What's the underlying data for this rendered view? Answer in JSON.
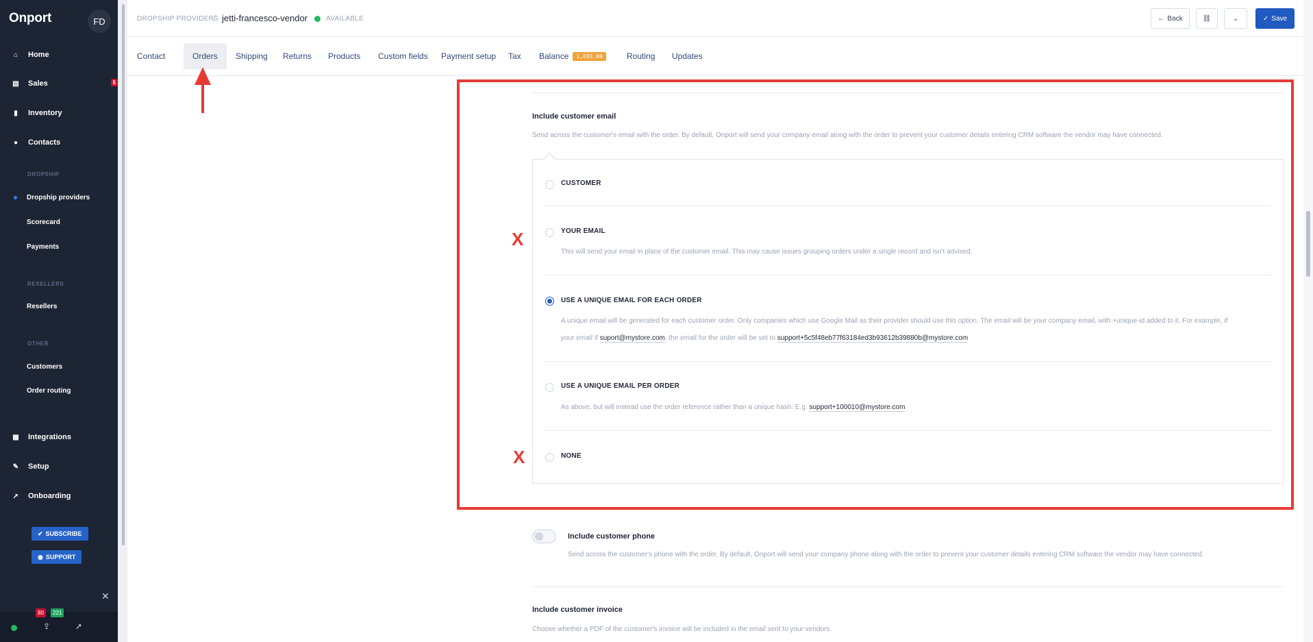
{
  "app": {
    "logo": "Onport",
    "user_initials": "FD"
  },
  "sidebar": {
    "nav": [
      {
        "label": "Home",
        "icon": "home-icon"
      },
      {
        "label": "Sales",
        "icon": "cart-icon",
        "badge": "5"
      },
      {
        "label": "Inventory",
        "icon": "bookmark-icon"
      },
      {
        "label": "Contacts",
        "icon": "user-icon"
      }
    ],
    "sections": {
      "dropship": "DROPSHIP",
      "resellers": "RESELLERS",
      "other": "OTHER"
    },
    "dropship_items": [
      "Dropship providers",
      "Scorecard",
      "Payments"
    ],
    "reseller_items": [
      "Resellers"
    ],
    "other_items": [
      "Customers",
      "Order routing"
    ],
    "bottom_nav": [
      {
        "label": "Integrations",
        "icon": "grid-icon"
      },
      {
        "label": "Setup",
        "icon": "wrench-icon"
      },
      {
        "label": "Onboarding",
        "icon": "rocket-icon"
      }
    ],
    "subscribe_label": "SUBSCRIBE",
    "support_label": "SUPPORT",
    "badge_red": "80",
    "badge_green": "221"
  },
  "header": {
    "breadcrumb_root": "DROPSHIP PROVIDERS",
    "separator": "/",
    "current": "jetti-francesco-vendor",
    "status": "AVAILABLE",
    "back_label": "Back",
    "save_label": "Save"
  },
  "tabs": [
    {
      "label": "Contact"
    },
    {
      "label": "Orders",
      "active": true
    },
    {
      "label": "Shipping"
    },
    {
      "label": "Returns"
    },
    {
      "label": "Products"
    },
    {
      "label": "Custom fields"
    },
    {
      "label": "Payment setup"
    },
    {
      "label": "Tax"
    },
    {
      "label": "Balance",
      "badge": "1,093.00"
    },
    {
      "label": "Routing"
    },
    {
      "label": "Updates"
    }
  ],
  "email_field": {
    "title": "Include customer email",
    "description": "Send across the customer's email with the order. By default, Onport will send your company email along with the order to prevent your customer details entering CRM software the vendor may have connected.",
    "options": [
      {
        "label": "CUSTOMER",
        "checked": false
      },
      {
        "label": "YOUR EMAIL",
        "checked": false,
        "desc": "This will send your email in place of the customer email. This may cause issues grouping orders under a single record and isn't advised."
      },
      {
        "label": "USE A UNIQUE EMAIL FOR EACH ORDER",
        "checked": true,
        "desc_line1": "A unique email will be generated for each customer order. Only companies which use Google Mail as their provider should use this option. The email will be your company email, with +unique-id added to it. For example, if",
        "desc_line2_a": "your email if ",
        "desc_line2_email1": "suport@mystore.com",
        "desc_line2_b": ", the email for the order will be set to ",
        "desc_line2_email2": "support+5c5f48eb77f63184ed3b93612b39880b@mystore.com"
      },
      {
        "label": "USE A UNIQUE EMAIL PER ORDER",
        "checked": false,
        "desc_a": "As above, but will instead use the order reference rather than a unique hash. E.g. ",
        "desc_email": "support+100010@mystore.com"
      },
      {
        "label": "NONE",
        "checked": false
      }
    ]
  },
  "phone_field": {
    "title": "Include customer phone",
    "description": "Send across the customer's phone with the order. By default, Onport will send your company phone along with the order to prevent your customer details entering CRM software the vendor may have connected."
  },
  "invoice_field": {
    "title": "Include customer invoice",
    "description": "Choose whether a PDF of the customer's invoice will be included in the email sent to your vendors."
  },
  "annotations": {
    "x_mark": "X",
    "color": "#e63b35"
  }
}
